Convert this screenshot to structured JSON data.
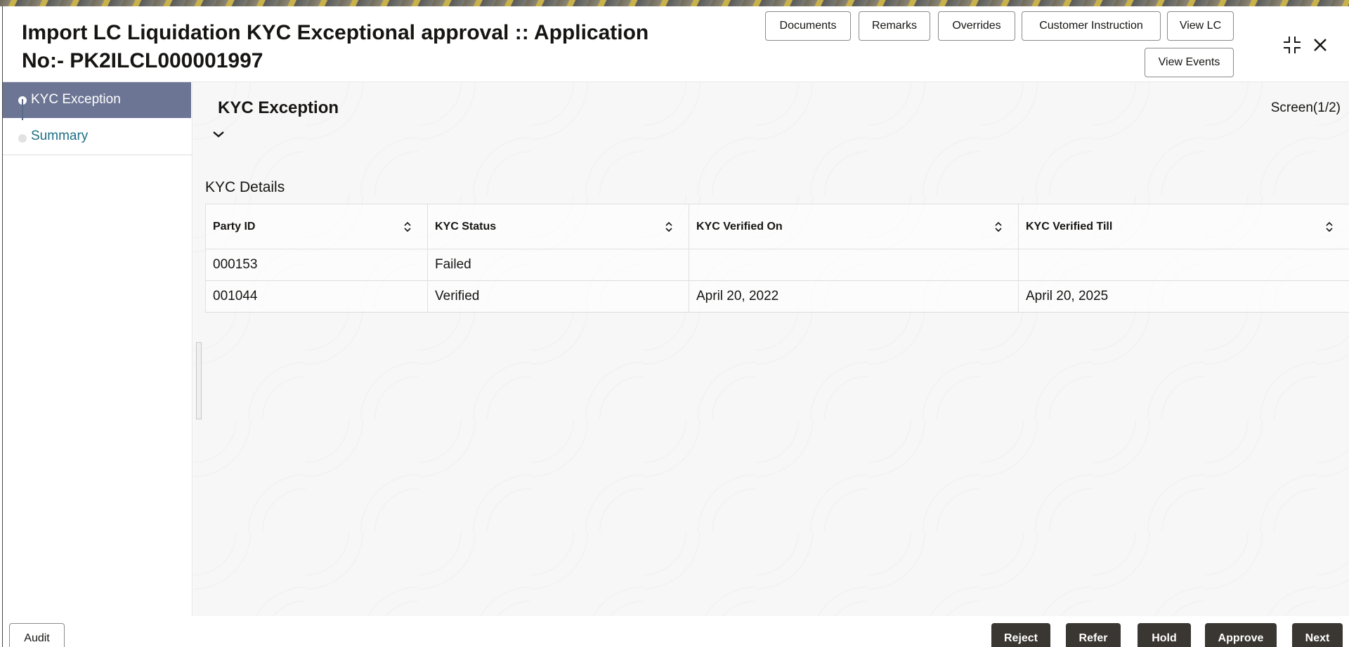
{
  "header": {
    "title": "Import LC Liquidation KYC Exceptional approval :: Application No:- PK2ILCL000001997",
    "buttons": {
      "documents": "Documents",
      "remarks": "Remarks",
      "overrides": "Overrides",
      "customer_instruction": "Customer Instruction",
      "view_lc": "View LC",
      "view_events": "View Events"
    }
  },
  "sidebar": {
    "items": [
      {
        "label": "KYC Exception",
        "active": true
      },
      {
        "label": "Summary",
        "active": false
      }
    ]
  },
  "main": {
    "section_title": "KYC Exception",
    "screen_count": "Screen(1/2)",
    "kyc_details_title": "KYC Details",
    "table": {
      "columns": [
        "Party ID",
        "KYC Status",
        "KYC Verified On",
        "KYC Verified Till"
      ],
      "rows": [
        [
          "000153",
          "Failed",
          "",
          ""
        ],
        [
          "001044",
          "Verified",
          "April 20, 2022",
          "April 20, 2025"
        ]
      ]
    }
  },
  "footer": {
    "audit": "Audit",
    "reject": "Reject",
    "refer": "Refer",
    "hold": "Hold",
    "approve": "Approve",
    "next": "Next"
  },
  "colors": {
    "sidebar_active": "#6c7594",
    "link": "#1d6e86",
    "dark_button": "#3a3631"
  }
}
